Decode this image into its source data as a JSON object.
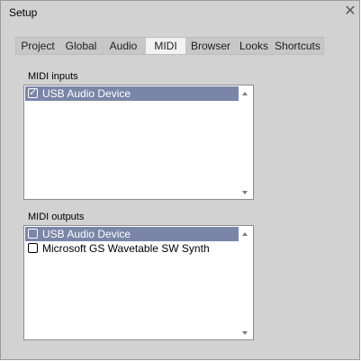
{
  "window": {
    "title": "Setup",
    "close_glyph": "✕"
  },
  "tabs": [
    {
      "label": "Project",
      "active": false
    },
    {
      "label": "Global",
      "active": false
    },
    {
      "label": "Audio",
      "active": false
    },
    {
      "label": "MIDI",
      "active": true
    },
    {
      "label": "Browser",
      "active": false
    },
    {
      "label": "Looks",
      "active": false
    },
    {
      "label": "Shortcuts",
      "active": false
    }
  ],
  "midi_inputs": {
    "label": "MIDI inputs",
    "items": [
      {
        "label": "USB Audio Device",
        "checked": true,
        "selected": true
      }
    ]
  },
  "midi_outputs": {
    "label": "MIDI outputs",
    "items": [
      {
        "label": "USB Audio Device",
        "checked": false,
        "selected": true
      },
      {
        "label": "Microsoft GS Wavetable SW Synth",
        "checked": false,
        "selected": false
      }
    ]
  },
  "colors": {
    "window_bg": "#d2d2d2",
    "selection": "#7a86a8",
    "active_tab": "#f2f2f2"
  },
  "icons": {
    "checkmark": "✓"
  }
}
